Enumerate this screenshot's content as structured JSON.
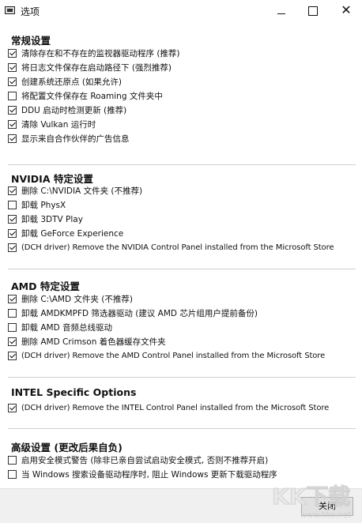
{
  "window": {
    "title": "选项"
  },
  "sections": [
    {
      "title": "常规设置",
      "options": [
        {
          "label": "清除存在和不存在的监视器驱动程序 (推荐)",
          "checked": true
        },
        {
          "label": "将日志文件保存在启动路径下 (强烈推荐)",
          "checked": true
        },
        {
          "label": "创建系统还原点 (如果允许)",
          "checked": true
        },
        {
          "label": "将配置文件保存在 Roaming 文件夹中",
          "checked": false
        },
        {
          "label": "DDU 启动时检测更新 (推荐)",
          "checked": true
        },
        {
          "label": "清除 Vulkan 运行时",
          "checked": true
        },
        {
          "label": "显示来自合作伙伴的广告信息",
          "checked": true
        }
      ]
    },
    {
      "title": "NVIDIA 特定设置",
      "options": [
        {
          "label": "删除 C:\\NVIDIA 文件夹 (不推荐)",
          "checked": true
        },
        {
          "label": "卸载 PhysX",
          "checked": false
        },
        {
          "label": "卸载 3DTV Play",
          "checked": true
        },
        {
          "label": "卸载 GeForce Experience",
          "checked": true
        },
        {
          "label": "(DCH driver) Remove the NVIDIA Control Panel installed from the Microsoft Store",
          "checked": true
        }
      ]
    },
    {
      "title": "AMD 特定设置",
      "options": [
        {
          "label": "删除 C:\\AMD 文件夹 (不推荐)",
          "checked": true
        },
        {
          "label": "卸载 AMDKMPFD 筛选器驱动 (建议 AMD 芯片组用户提前备份)",
          "checked": false
        },
        {
          "label": "卸载 AMD 音频总线驱动",
          "checked": false
        },
        {
          "label": "删除 AMD Crimson 着色器缓存文件夹",
          "checked": true
        },
        {
          "label": "(DCH driver) Remove the AMD Control Panel installed from the Microsoft Store",
          "checked": true
        }
      ]
    },
    {
      "title": "INTEL Specific Options",
      "options": [
        {
          "label": "(DCH driver) Remove the INTEL Control Panel installed from the Microsoft Store",
          "checked": true
        }
      ]
    },
    {
      "title": "高级设置 (更改后果自负)",
      "options": [
        {
          "label": "启用安全模式警告 (除非已亲自尝试启动安全模式, 否则不推荐开启)",
          "checked": false
        },
        {
          "label": "当 Windows 搜索设备驱动程序时, 阻止 Windows 更新下载驱动程序",
          "checked": false
        }
      ]
    }
  ],
  "footer": {
    "close_label": "关闭"
  },
  "watermark": {
    "text": "KK下载",
    "url": "www.kkx.net"
  },
  "icons": {
    "minimize": "minimize-icon",
    "maximize": "maximize-icon",
    "close": "close-icon"
  }
}
